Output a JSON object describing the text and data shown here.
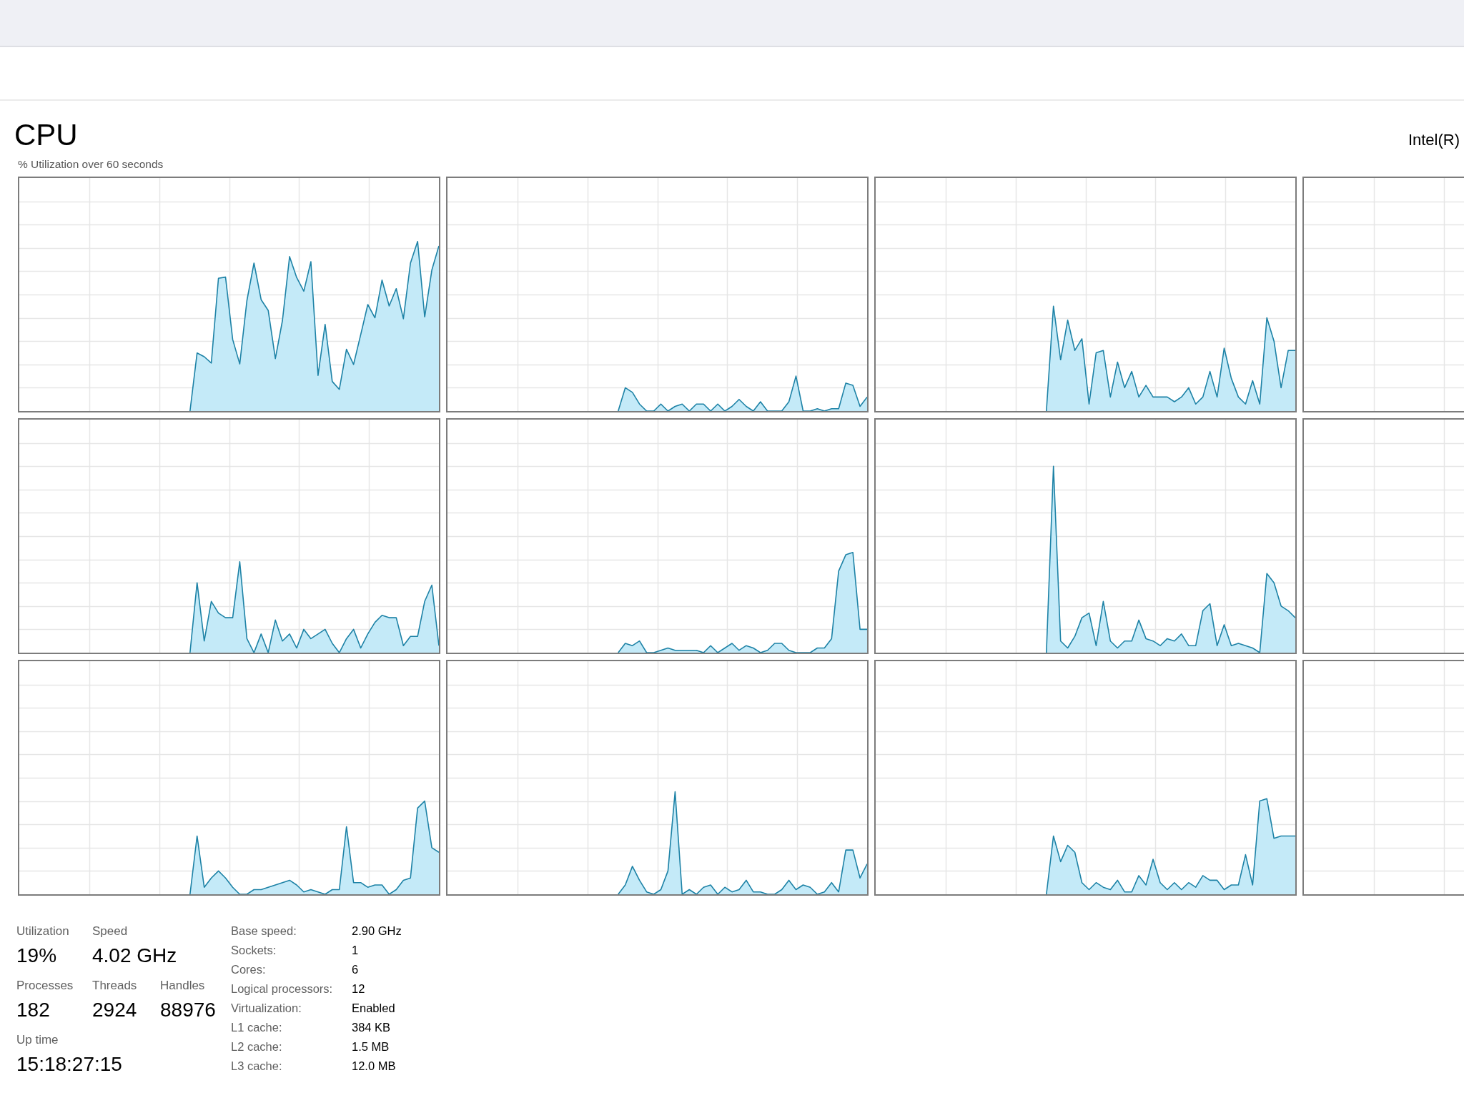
{
  "header": {
    "title": "CPU",
    "processor_name": "Intel(R)"
  },
  "graph_caption": "% Utilization over 60 seconds",
  "stat_rows": [
    [
      {
        "label": "Utilization",
        "value": "19%"
      },
      {
        "label": "Speed",
        "value": "4.02 GHz"
      }
    ],
    [
      {
        "label": "Processes",
        "value": "182"
      },
      {
        "label": "Threads",
        "value": "2924"
      },
      {
        "label": "Handles",
        "value": "88976"
      }
    ],
    [
      {
        "label": "Up time",
        "value": "15:18:27:15"
      }
    ]
  ],
  "details": [
    {
      "label": "Base speed:",
      "value": "2.90 GHz"
    },
    {
      "label": "Sockets:",
      "value": "1"
    },
    {
      "label": "Cores:",
      "value": "6"
    },
    {
      "label": "Logical processors:",
      "value": "12"
    },
    {
      "label": "Virtualization:",
      "value": "Enabled"
    },
    {
      "label": "L1 cache:",
      "value": "384 KB"
    },
    {
      "label": "L2 cache:",
      "value": "1.5 MB"
    },
    {
      "label": "L3 cache:",
      "value": "12.0 MB"
    }
  ]
}
